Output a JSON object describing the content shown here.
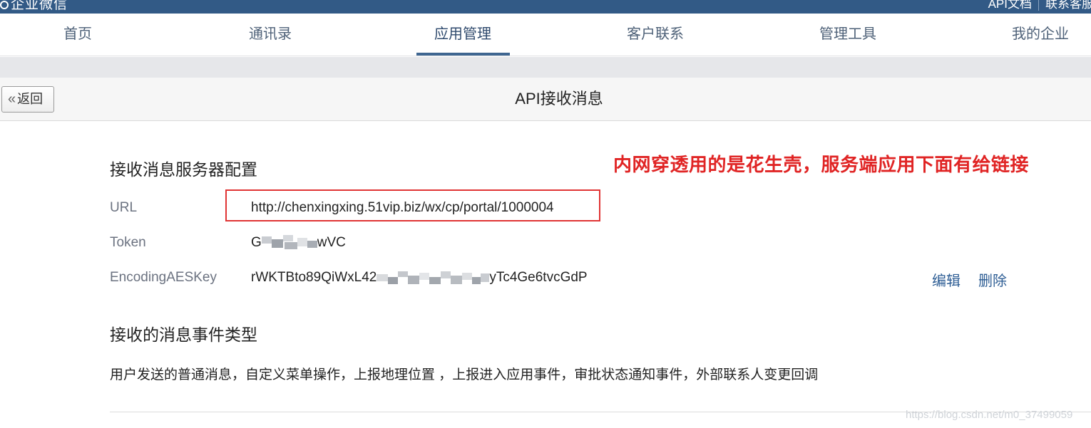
{
  "topbar": {
    "logo_text": "企业微信",
    "link_1": "API文档",
    "link_2": "联系客服"
  },
  "nav": {
    "tabs": [
      "首页",
      "通讯录",
      "应用管理",
      "客户联系",
      "管理工具",
      "我的企业"
    ],
    "active_index": 2
  },
  "titlebar": {
    "back_label": "返回",
    "title": "API接收消息"
  },
  "server_config": {
    "heading": "接收消息服务器配置",
    "url_label": "URL",
    "url_value": "http://chenxingxing.51vip.biz/wx/cp/portal/1000004",
    "token_label": "Token",
    "token_value_start": "G",
    "token_value_end": "wVC",
    "aeskey_label": "EncodingAESKey",
    "aeskey_value_start": "rWKTBto89QiWxL42",
    "aeskey_value_end": "yTc4Ge6tvcGdP",
    "edit_label": "编辑",
    "delete_label": "删除"
  },
  "annotation_text": "内网穿透用的是花生壳，服务端应用下面有给链接",
  "event_types": {
    "heading": "接收的消息事件类型",
    "list_text": "用户发送的普通消息，自定义菜单操作，上报地理位置 ，上报进入应用事件，审批状态通知事件，外部联系人变更回调"
  },
  "watermark": "https://blog.csdn.net/m0_37499059",
  "colors": {
    "topbar_bg": "#325a86",
    "nav_active_underline": "#3f6691",
    "annotation_red": "#e02424",
    "link_blue": "#2d5d94"
  }
}
